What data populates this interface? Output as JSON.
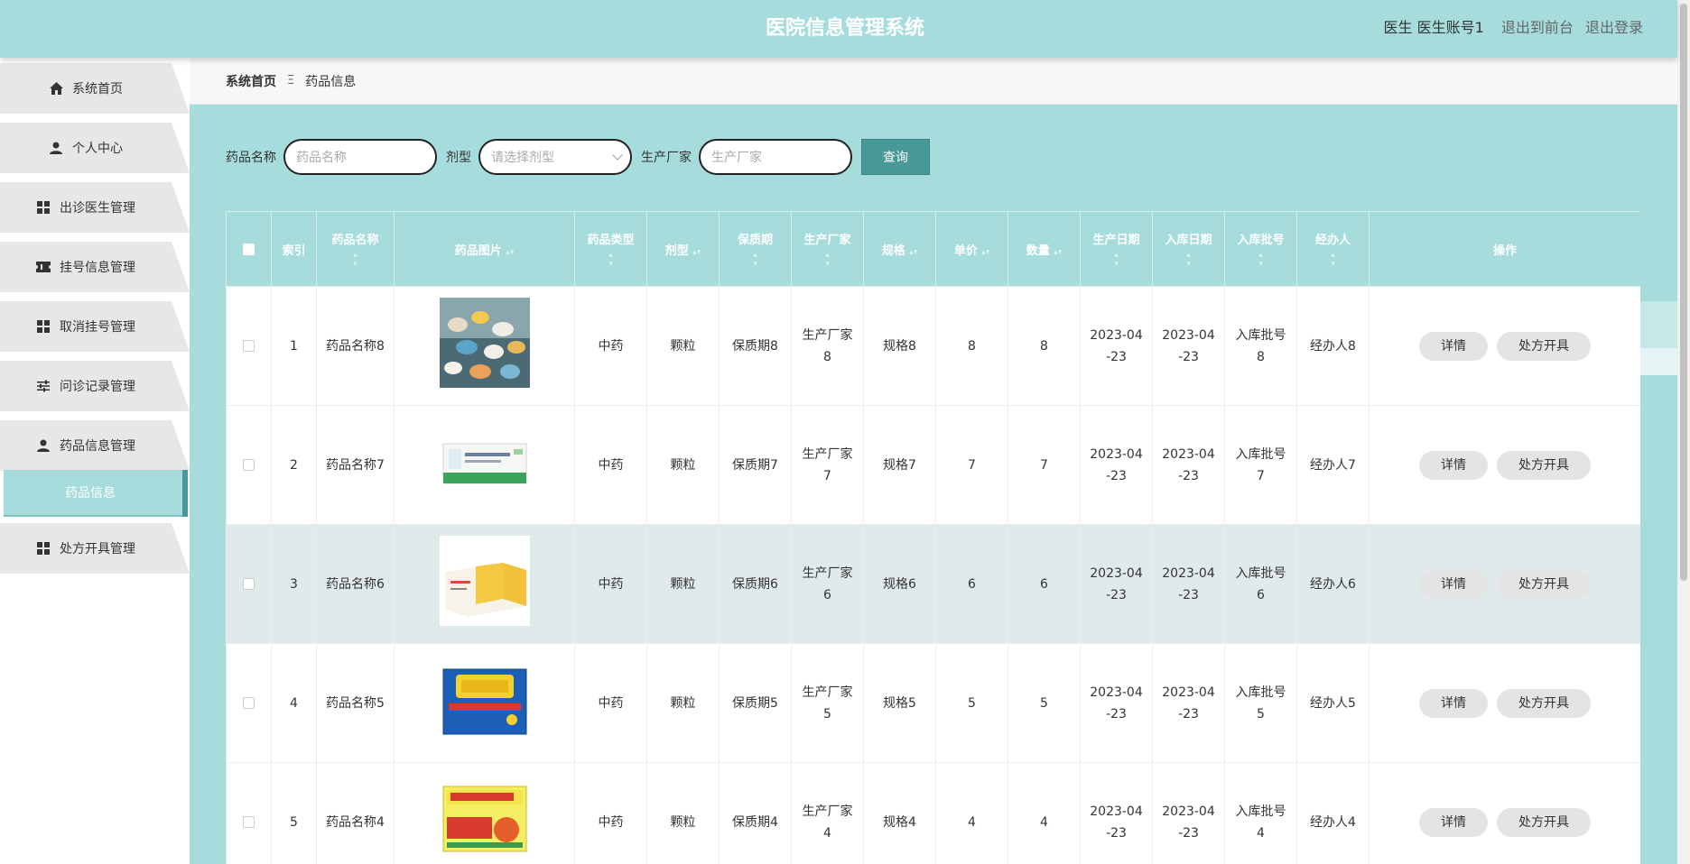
{
  "header": {
    "title": "医院信息管理系统",
    "user": "医生 医生账号1",
    "front_link": "退出到前台",
    "logout_link": "退出登录"
  },
  "sidebar": {
    "items": [
      {
        "label": "系统首页",
        "icon": "home-icon"
      },
      {
        "label": "个人中心",
        "icon": "user-icon"
      },
      {
        "label": "出诊医生管理",
        "icon": "grid-icon"
      },
      {
        "label": "挂号信息管理",
        "icon": "ticket-icon"
      },
      {
        "label": "取消挂号管理",
        "icon": "grid-icon"
      },
      {
        "label": "问诊记录管理",
        "icon": "sliders-icon"
      },
      {
        "label": "药品信息管理",
        "icon": "user-icon"
      },
      {
        "label": "处方开具管理",
        "icon": "grid-icon"
      }
    ],
    "sub_item": "药品信息"
  },
  "breadcrumb": {
    "home": "系统首页",
    "sep": "Ξ",
    "current": "药品信息"
  },
  "search": {
    "name_label": "药品名称",
    "name_placeholder": "药品名称",
    "form_label": "剂型",
    "form_placeholder": "请选择剂型",
    "maker_label": "生产厂家",
    "maker_placeholder": "生产厂家",
    "query_button": "查询"
  },
  "table": {
    "columns": [
      "索引",
      "药品名称",
      "药品图片",
      "药品类型",
      "剂型",
      "保质期",
      "生产厂家",
      "规格",
      "单价",
      "数量",
      "生产日期",
      "入库日期",
      "入库批号",
      "经办人",
      "操作"
    ],
    "detail_label": "详情",
    "prescribe_label": "处方开具",
    "rows": [
      {
        "idx": "1",
        "name": "药品名称8",
        "type": "中药",
        "form": "颗粒",
        "shelf": "保质期8",
        "maker": "生产厂家8",
        "spec": "规格8",
        "price": "8",
        "qty": "8",
        "prod_date": "2023-04-23",
        "in_date": "2023-04-23",
        "batch": "入库批号8",
        "handler": "经办人8"
      },
      {
        "idx": "2",
        "name": "药品名称7",
        "type": "中药",
        "form": "颗粒",
        "shelf": "保质期7",
        "maker": "生产厂家7",
        "spec": "规格7",
        "price": "7",
        "qty": "7",
        "prod_date": "2023-04-23",
        "in_date": "2023-04-23",
        "batch": "入库批号7",
        "handler": "经办人7"
      },
      {
        "idx": "3",
        "name": "药品名称6",
        "type": "中药",
        "form": "颗粒",
        "shelf": "保质期6",
        "maker": "生产厂家6",
        "spec": "规格6",
        "price": "6",
        "qty": "6",
        "prod_date": "2023-04-23",
        "in_date": "2023-04-23",
        "batch": "入库批号6",
        "handler": "经办人6"
      },
      {
        "idx": "4",
        "name": "药品名称5",
        "type": "中药",
        "form": "颗粒",
        "shelf": "保质期5",
        "maker": "生产厂家5",
        "spec": "规格5",
        "price": "5",
        "qty": "5",
        "prod_date": "2023-04-23",
        "in_date": "2023-04-23",
        "batch": "入库批号5",
        "handler": "经办人5"
      },
      {
        "idx": "5",
        "name": "药品名称4",
        "type": "中药",
        "form": "颗粒",
        "shelf": "保质期4",
        "maker": "生产厂家4",
        "spec": "规格4",
        "price": "4",
        "qty": "4",
        "prod_date": "2023-04-23",
        "in_date": "2023-04-23",
        "batch": "入库批号4",
        "handler": "经办人4"
      }
    ]
  },
  "colors": {
    "accent": "#a6dcdc",
    "button": "#4a9999",
    "highlight_row": "#e1eaea"
  }
}
